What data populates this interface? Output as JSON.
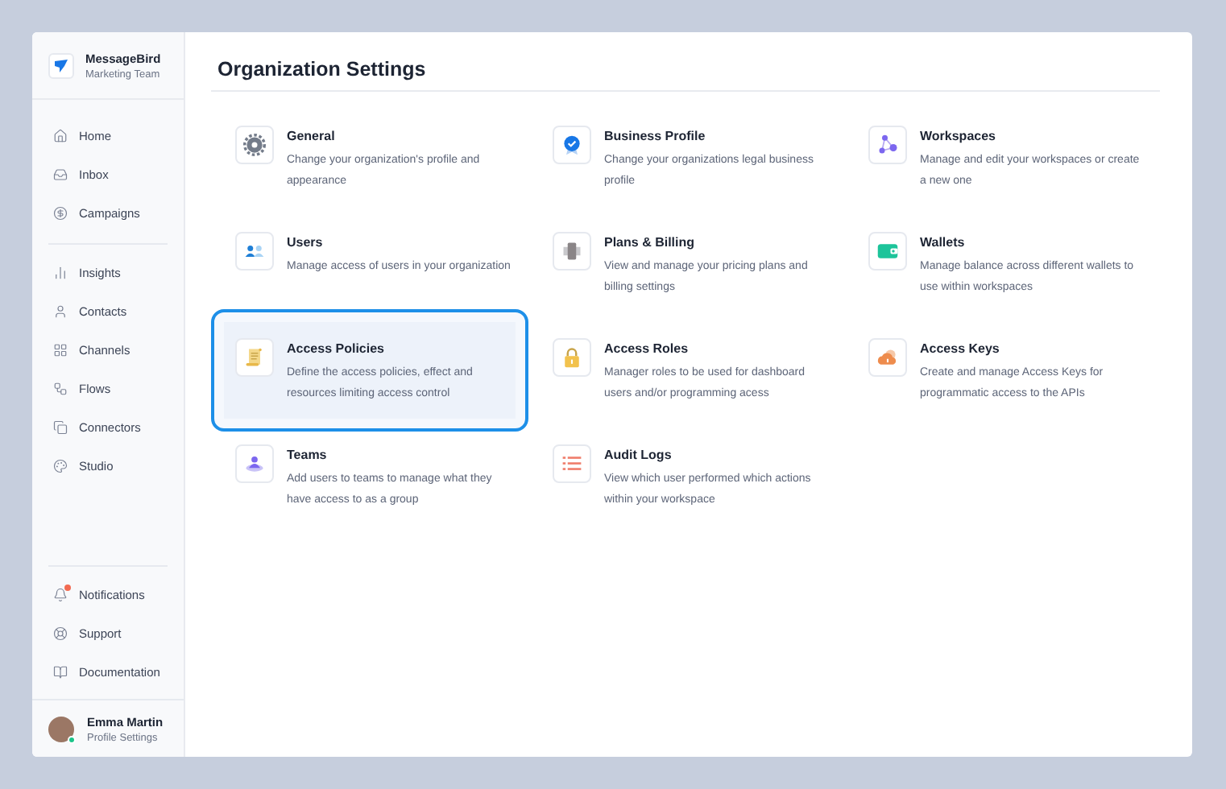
{
  "workspace": {
    "name": "MessageBird",
    "team": "Marketing Team"
  },
  "nav_groups": [
    [
      {
        "label": "Home"
      },
      {
        "label": "Inbox"
      },
      {
        "label": "Campaigns"
      }
    ],
    [
      {
        "label": "Insights"
      },
      {
        "label": "Contacts"
      },
      {
        "label": "Channels"
      },
      {
        "label": "Flows"
      },
      {
        "label": "Connectors"
      },
      {
        "label": "Studio"
      }
    ]
  ],
  "bottom_nav": [
    {
      "label": "Notifications",
      "alert": true
    },
    {
      "label": "Support",
      "alert": false
    },
    {
      "label": "Documentation",
      "alert": false
    }
  ],
  "user": {
    "name": "Emma Martin",
    "subtitle": "Profile Settings",
    "online": true
  },
  "page_title": "Organization Settings",
  "settings": [
    {
      "title": "General",
      "description": "Change your organization's profile and appearance",
      "selected": false
    },
    {
      "title": "Business Profile",
      "description": "Change your organizations legal business profile",
      "selected": false
    },
    {
      "title": "Workspaces",
      "description": "Manage and edit your workspaces or create a new one",
      "selected": false
    },
    {
      "title": "Users",
      "description": "Manage access of users in your organization",
      "selected": false
    },
    {
      "title": "Plans & Billing",
      "description": "View and manage your pricing plans and billing settings",
      "selected": false
    },
    {
      "title": "Wallets",
      "description": "Manage balance across different wallets to use within workspaces",
      "selected": false
    },
    {
      "title": "Access Policies",
      "description": "Define the access policies, effect and resources limiting access control",
      "selected": true
    },
    {
      "title": "Access Roles",
      "description": "Manager roles to be used for dashboard users and/or programming acess",
      "selected": false
    },
    {
      "title": "Access Keys",
      "description": "Create and manage Access Keys for programmatic access to the APIs",
      "selected": false
    },
    {
      "title": "Teams",
      "description": "Add users to teams to manage what they have access to as a group",
      "selected": false
    },
    {
      "title": "Audit Logs",
      "description": "View which user performed which actions within your workspace",
      "selected": false
    }
  ]
}
